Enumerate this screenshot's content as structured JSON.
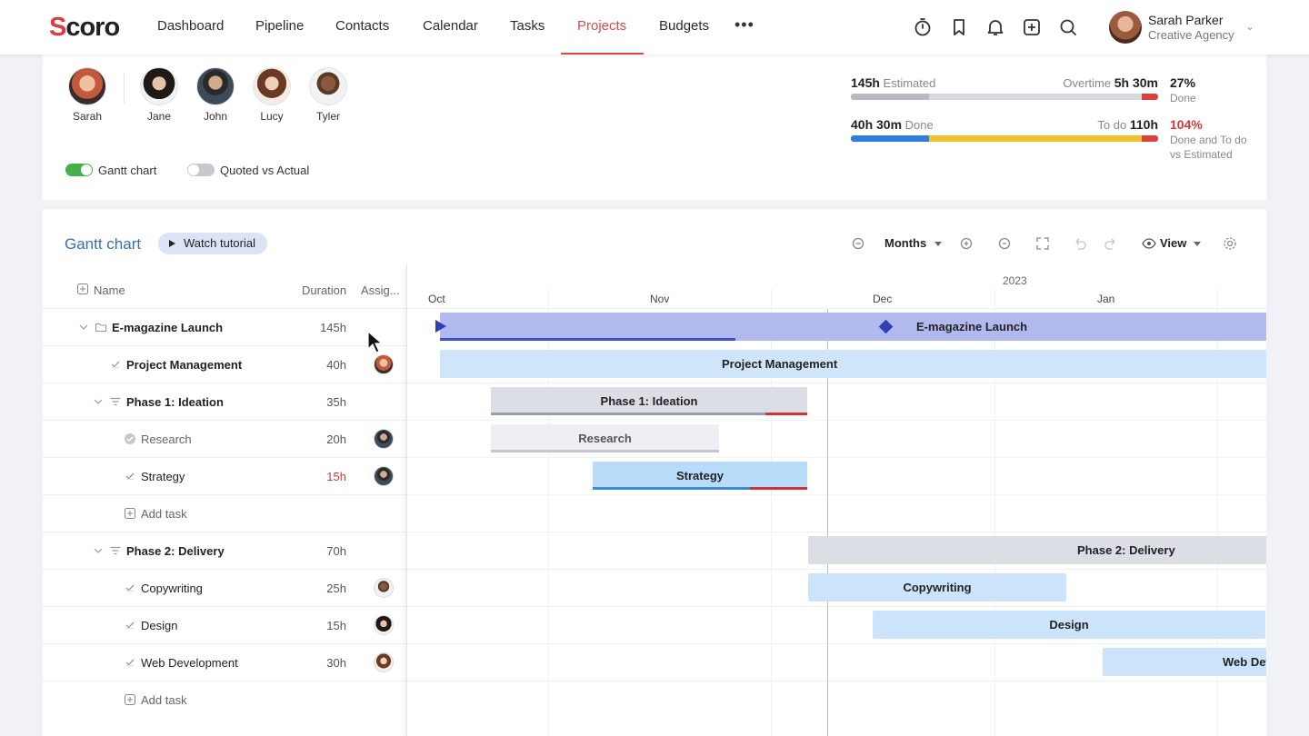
{
  "brand": {
    "logo_s": "S",
    "logo_rest": "coro"
  },
  "nav": {
    "items": [
      "Dashboard",
      "Pipeline",
      "Contacts",
      "Calendar",
      "Tasks",
      "Projects",
      "Budgets"
    ],
    "active": "Projects",
    "more": "•••",
    "icons": [
      "timer-icon",
      "bookmark-icon",
      "bell-icon",
      "add-icon",
      "search-icon"
    ]
  },
  "user": {
    "name": "Sarah Parker",
    "org": "Creative Agency",
    "chevron": "⌄"
  },
  "team": {
    "members": [
      {
        "name": "Sarah"
      },
      {
        "name": "Jane"
      },
      {
        "name": "John"
      },
      {
        "name": "Lucy"
      },
      {
        "name": "Tyler"
      }
    ]
  },
  "toggles": {
    "gantt": {
      "label": "Gantt chart",
      "on": true
    },
    "quoted": {
      "label": "Quoted vs Actual",
      "on": false
    }
  },
  "summary": {
    "estimated": {
      "value": "145h",
      "label": "Estimated"
    },
    "overtime": {
      "label": "Overtime",
      "value": "5h 30m"
    },
    "done_pct": {
      "value": "27%",
      "label": "Done"
    },
    "done": {
      "value": "40h 30m",
      "label": "Done"
    },
    "todo": {
      "label": "To do",
      "value": "110h"
    },
    "combined_pct": {
      "value": "104%",
      "label_1": "Done and To do",
      "label_2": "vs Estimated"
    },
    "colors": {
      "grey": "#c9ccd3",
      "red": "#e0403c",
      "blue": "#2f7de0",
      "yellow": "#f2c12e"
    }
  },
  "gantt": {
    "title": "Gantt chart",
    "watch_tutorial": "Watch tutorial",
    "scale": "Months",
    "view": "View",
    "columns": {
      "name": "Name",
      "duration": "Duration",
      "assignee": "Assig..."
    },
    "year": "2023",
    "months": [
      "Oct",
      "Nov",
      "Dec",
      "Jan"
    ],
    "rows": [
      {
        "name": "E-magazine Launch",
        "duration": "145h",
        "level": 0,
        "type": "project"
      },
      {
        "name": "Project Management",
        "duration": "40h",
        "level": 1,
        "type": "task"
      },
      {
        "name": "Phase 1: Ideation",
        "duration": "35h",
        "level": 1,
        "type": "phase"
      },
      {
        "name": "Research",
        "duration": "20h",
        "level": 2,
        "type": "done-task"
      },
      {
        "name": "Strategy",
        "duration": "15h",
        "level": 2,
        "type": "task",
        "overdue": true
      },
      {
        "name": "Add task",
        "duration": "",
        "level": 2,
        "type": "add"
      },
      {
        "name": "Phase 2: Delivery",
        "duration": "70h",
        "level": 1,
        "type": "phase"
      },
      {
        "name": "Copywriting",
        "duration": "25h",
        "level": 2,
        "type": "task"
      },
      {
        "name": "Design",
        "duration": "15h",
        "level": 2,
        "type": "task"
      },
      {
        "name": "Web Development",
        "duration": "30h",
        "level": 2,
        "type": "task"
      },
      {
        "name": "Add task",
        "duration": "",
        "level": 2,
        "type": "add"
      }
    ],
    "bars": [
      {
        "label": "E-magazine Launch"
      },
      {
        "label": "Project Management"
      },
      {
        "label": "Phase 1: Ideation"
      },
      {
        "label": "Research"
      },
      {
        "label": "Strategy"
      },
      {
        "label": "Phase 2: Delivery"
      },
      {
        "label": "Copywriting"
      },
      {
        "label": "Design"
      },
      {
        "label": "Web Dev"
      }
    ]
  }
}
